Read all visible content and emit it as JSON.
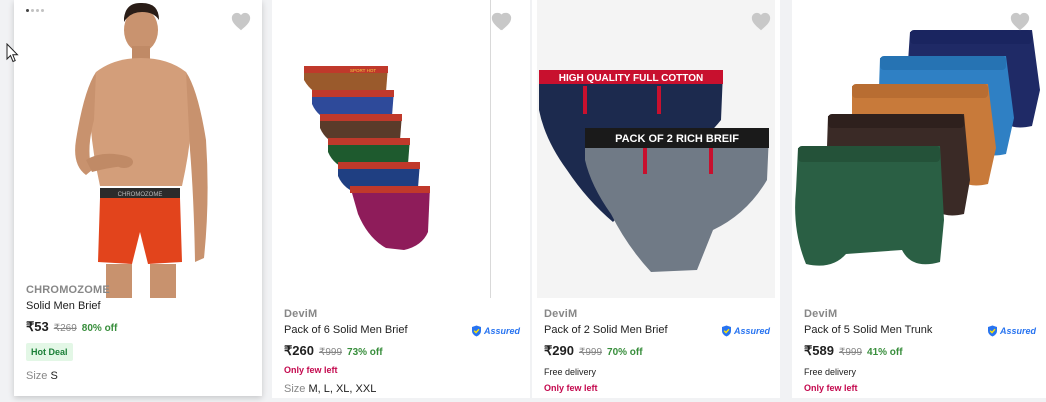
{
  "products": [
    {
      "brand": "CHROMOZOME",
      "title": "Solid Men Brief",
      "price": "₹53",
      "mrp": "₹269",
      "discount": "80% off",
      "badge": "Hot Deal",
      "size_label": "Size",
      "sizes": "S",
      "waistband_text": "CHROMOZOME"
    },
    {
      "brand": "DeviM",
      "title": "Pack of 6 Solid Men Brief",
      "assured": "Assured",
      "price": "₹260",
      "mrp": "₹999",
      "discount": "73% off",
      "stock": "Only few left",
      "size_label": "Size",
      "sizes": "M, L, XL, XXL",
      "waistband_text": "SPORT HOT"
    },
    {
      "brand": "DeviM",
      "title": "Pack of 2 Solid Men Brief",
      "assured": "Assured",
      "price": "₹290",
      "mrp": "₹999",
      "discount": "70% off",
      "delivery": "Free delivery",
      "stock": "Only few left",
      "banner_top": "HIGH QUALITY FULL COTTON",
      "banner_bottom": "PACK OF 2 RICH BREIF"
    },
    {
      "brand": "DeviM",
      "title": "Pack of 5 Solid Men Trunk",
      "assured": "Assured",
      "price": "₹589",
      "mrp": "₹999",
      "discount": "41% off",
      "delivery": "Free delivery",
      "stock": "Only few left"
    }
  ],
  "colors": {
    "accent": "#2874f0",
    "discount": "#388e3c",
    "stock": "#c4094e",
    "heart": "#c8c8c8"
  },
  "icons": [
    "heart-icon",
    "assured-shield-icon",
    "mouse-pointer-icon"
  ]
}
